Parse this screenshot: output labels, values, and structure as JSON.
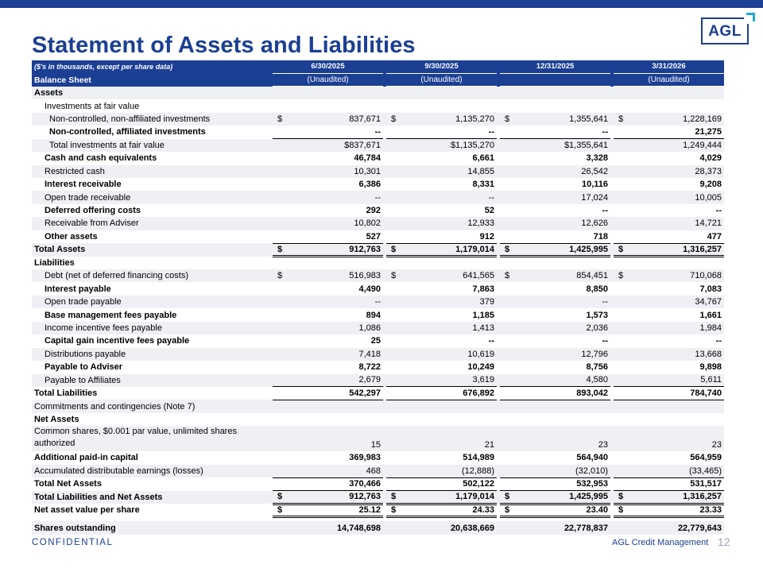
{
  "title": "Statement of Assets and Liabilities",
  "logo_text": "AGL",
  "header": {
    "units_label": "($'s in thousands, except per share data)",
    "periods": [
      "6/30/2025",
      "9/30/2025",
      "12/31/2025",
      "3/31/2026"
    ],
    "section_label": "Balance Sheet",
    "audit": [
      "(Unaudited)",
      "(Unaudited)",
      "",
      "(Unaudited)"
    ]
  },
  "rows": [
    {
      "label": "Assets",
      "bold": true,
      "indent": 0,
      "values": [
        "",
        "",
        "",
        ""
      ]
    },
    {
      "label": "Investments at fair value",
      "bold": false,
      "indent": 1,
      "values": [
        "",
        "",
        "",
        ""
      ]
    },
    {
      "label": "Non-controlled, non-affiliated investments",
      "bold": false,
      "indent": 2,
      "dollar": [
        "$",
        "$",
        "$",
        "$"
      ],
      "values": [
        "837,671",
        "1,135,270",
        "1,355,641",
        "1,228,169"
      ]
    },
    {
      "label": "Non-controlled, affiliated investments",
      "bold": true,
      "indent": 2,
      "values": [
        "--",
        "--",
        "--",
        "21,275"
      ],
      "rule": "single"
    },
    {
      "label": "Total investments at fair value",
      "bold": false,
      "indent": 2,
      "values": [
        "$837,671",
        "$1,135,270",
        "$1,355,641",
        "1,249,444"
      ]
    },
    {
      "label": "Cash and cash equivalents",
      "bold": true,
      "indent": 1,
      "values": [
        "46,784",
        "6,661",
        "3,328",
        "4,029"
      ]
    },
    {
      "label": "Restricted cash",
      "bold": false,
      "indent": 1,
      "values": [
        "10,301",
        "14,855",
        "26,542",
        "28,373"
      ]
    },
    {
      "label": "Interest receivable",
      "bold": true,
      "indent": 1,
      "values": [
        "6,386",
        "8,331",
        "10,116",
        "9,208"
      ]
    },
    {
      "label": "Open trade receivable",
      "bold": false,
      "indent": 1,
      "values": [
        "--",
        "--",
        "17,024",
        "10,005"
      ]
    },
    {
      "label": "Deferred offering costs",
      "bold": true,
      "indent": 1,
      "values": [
        "292",
        "52",
        "--",
        "--"
      ]
    },
    {
      "label": "Receivable from Adviser",
      "bold": false,
      "indent": 1,
      "values": [
        "10,802",
        "12,933",
        "12,626",
        "14,721"
      ]
    },
    {
      "label": "Other assets",
      "bold": true,
      "indent": 1,
      "values": [
        "527",
        "912",
        "718",
        "477"
      ],
      "rule": "single"
    },
    {
      "label": "Total Assets",
      "bold": true,
      "indent": 0,
      "dollar": [
        "$",
        "$",
        "$",
        "$"
      ],
      "values": [
        "912,763",
        "1,179,014",
        "1,425,995",
        "1,316,257"
      ],
      "rule": "double"
    },
    {
      "label": "Liabilities",
      "bold": true,
      "indent": 0,
      "values": [
        "",
        "",
        "",
        ""
      ]
    },
    {
      "label": "Debt (net of deferred financing costs)",
      "bold": false,
      "indent": 1,
      "dollar": [
        "$",
        "$",
        "$",
        "$"
      ],
      "values": [
        "516,983",
        "641,565",
        "854,451",
        "710,068"
      ]
    },
    {
      "label": "Interest payable",
      "bold": true,
      "indent": 1,
      "values": [
        "4,490",
        "7,863",
        "8,850",
        "7,083"
      ]
    },
    {
      "label": "Open trade payable",
      "bold": false,
      "indent": 1,
      "values": [
        "--",
        "379",
        "--",
        "34,767"
      ]
    },
    {
      "label": "Base management fees payable",
      "bold": true,
      "indent": 1,
      "values": [
        "894",
        "1,185",
        "1,573",
        "1,661"
      ]
    },
    {
      "label": "Income incentive fees payable",
      "bold": false,
      "indent": 1,
      "values": [
        "1,086",
        "1,413",
        "2,036",
        "1,984"
      ]
    },
    {
      "label": "Capital gain incentive fees payable",
      "bold": true,
      "indent": 1,
      "values": [
        "25",
        "--",
        "--",
        "--"
      ]
    },
    {
      "label": "Distributions payable",
      "bold": false,
      "indent": 1,
      "values": [
        "7,418",
        "10,619",
        "12,796",
        "13,668"
      ]
    },
    {
      "label": "Payable to Adviser",
      "bold": true,
      "indent": 1,
      "values": [
        "8,722",
        "10,249",
        "8,756",
        "9,898"
      ]
    },
    {
      "label": "Payable to Affiliates",
      "bold": false,
      "indent": 1,
      "values": [
        "2,679",
        "3,619",
        "4,580",
        "5,611"
      ],
      "rule": "single"
    },
    {
      "label": "Total Liabilities",
      "bold": true,
      "indent": 0,
      "values": [
        "542,297",
        "676,892",
        "893,042",
        "784,740"
      ],
      "rule": "single"
    },
    {
      "label": "Commitments and contingencies (Note 7)",
      "bold": false,
      "indent": 0,
      "values": [
        "",
        "",
        "",
        ""
      ]
    },
    {
      "label": "Net Assets",
      "bold": true,
      "indent": 0,
      "values": [
        "",
        "",
        "",
        ""
      ]
    },
    {
      "label": "Common shares, $0.001 par value, unlimited shares authorized",
      "bold": false,
      "indent": 0,
      "two_line": true,
      "values": [
        "15",
        "21",
        "23",
        "23"
      ]
    },
    {
      "label": "Additional paid-in capital",
      "bold": true,
      "indent": 0,
      "values": [
        "369,983",
        "514,989",
        "564,940",
        "564,959"
      ]
    },
    {
      "label": "Accumulated distributable earnings (losses)",
      "bold": false,
      "indent": 0,
      "values": [
        "468",
        "(12,888)",
        "(32,010)",
        "(33,465)"
      ],
      "rule": "single"
    },
    {
      "label": "Total Net Assets",
      "bold": true,
      "indent": 0,
      "values": [
        "370,466",
        "502,122",
        "532,953",
        "531,517"
      ],
      "rule": "single"
    },
    {
      "label": "Total Liabilities and Net Assets",
      "bold": true,
      "indent": 0,
      "dollar": [
        "$",
        "$",
        "$",
        "$"
      ],
      "values": [
        "912,763",
        "1,179,014",
        "1,425,995",
        "1,316,257"
      ],
      "rule": "double"
    },
    {
      "label": "Net asset value per share",
      "bold": true,
      "indent": 0,
      "dollar": [
        "$",
        "$",
        "$",
        "$"
      ],
      "values": [
        "25.12",
        "24.33",
        "23.40",
        "23.33"
      ],
      "rule": "double"
    },
    {
      "label": "Shares outstanding",
      "bold": true,
      "indent": 0,
      "spaced": true,
      "values": [
        "14,748,698",
        "20,638,669",
        "22,778,837",
        "22,779,643"
      ]
    }
  ],
  "footer": {
    "confidential": "CONFIDENTIAL",
    "brand": "AGL Credit Management",
    "page_number": "12"
  },
  "colors": {
    "brand_navy": "#1b3f93",
    "accent_cyan": "#1fa7d8",
    "row_shade": "#eef0f4"
  }
}
